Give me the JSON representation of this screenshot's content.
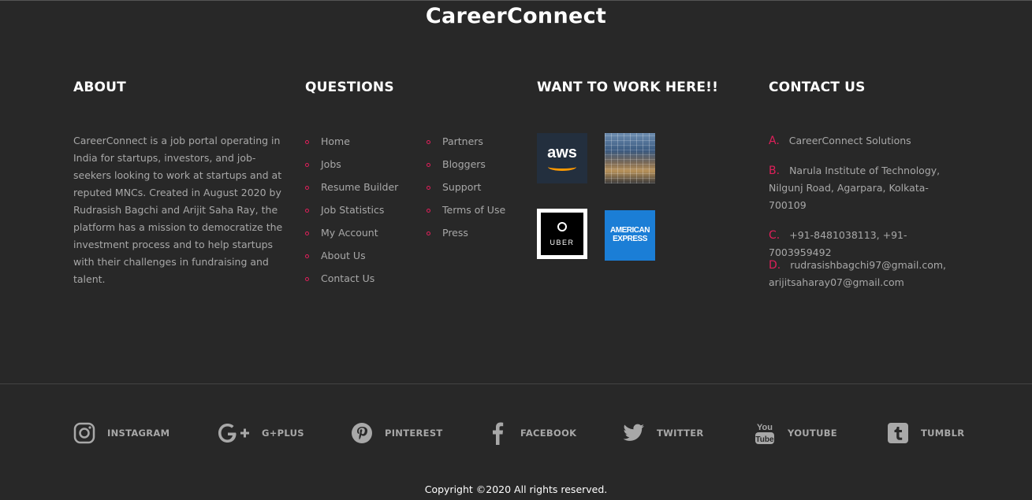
{
  "brand": "CareerConnect",
  "about": {
    "title": "ABOUT",
    "text": "CareerConnect is a job portal operating in India for startups, investors, and job-seekers looking to work at startups and at reputed MNCs. Created in August 2020 by Rudrasish Bagchi and Arijit Saha Ray, the platform has a mission to democratize the investment process and to help startups with their challenges in fundraising and talent."
  },
  "questions": {
    "title": "QUESTIONS",
    "col1": [
      "Home",
      "Jobs",
      "Resume Builder",
      "Job Statistics",
      "My Account",
      "About Us",
      "Contact Us"
    ],
    "col2": [
      "Partners",
      "Bloggers",
      "Support",
      "Terms of Use",
      "Press"
    ]
  },
  "work": {
    "title": "WANT TO WORK HERE!!",
    "logos": [
      {
        "name": "aws",
        "text": "aws"
      },
      {
        "name": "building",
        "text": ""
      },
      {
        "name": "uber",
        "text": "UBER"
      },
      {
        "name": "amex",
        "text": "AMERICAN EXPRESS"
      }
    ]
  },
  "contact": {
    "title": "CONTACT US",
    "items": [
      {
        "letter": "A.",
        "text": "CareerConnect Solutions"
      },
      {
        "letter": "B.",
        "text": "Narula Institute of Technology, Nilgunj Road, Agarpara, Kolkata-700109"
      },
      {
        "letter": "C.",
        "text": "+91-8481038113, +91-7003959492"
      },
      {
        "letter": "D.",
        "text": "rudrasishbagchi97@gmail.com, arijitsaharay07@gmail.com"
      }
    ]
  },
  "social": [
    {
      "icon": "instagram-icon",
      "label": "INSTAGRAM"
    },
    {
      "icon": "google-plus-icon",
      "label": "G+PLUS"
    },
    {
      "icon": "pinterest-icon",
      "label": "PINTEREST"
    },
    {
      "icon": "facebook-icon",
      "label": "FACEBOOK"
    },
    {
      "icon": "twitter-icon",
      "label": "TWITTER"
    },
    {
      "icon": "youtube-icon",
      "label": "YOUTUBE"
    },
    {
      "icon": "tumblr-icon",
      "label": "TUMBLR"
    }
  ],
  "copyright": "Copyright ©2020 All rights reserved.",
  "colors": {
    "accent": "#e01f5a",
    "background": "#282828"
  }
}
